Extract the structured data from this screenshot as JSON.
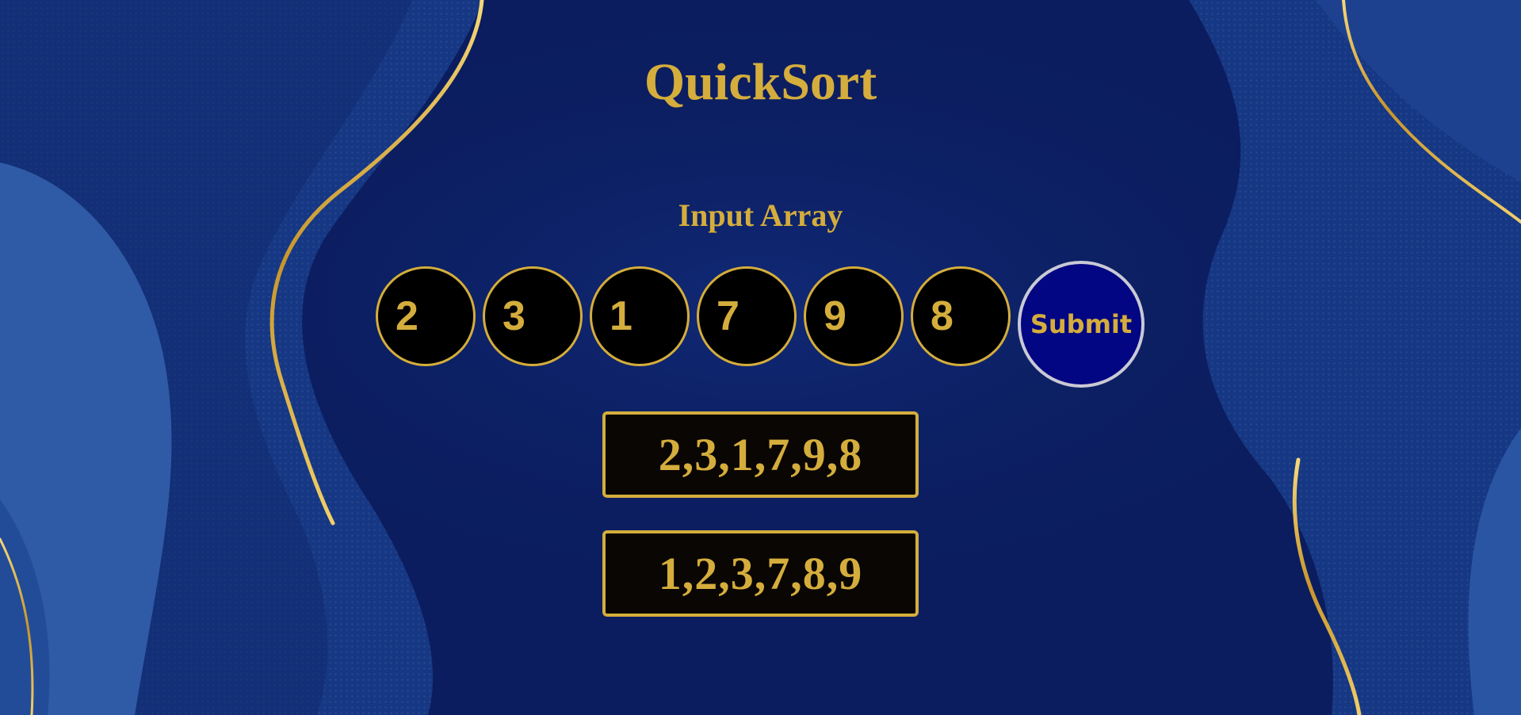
{
  "page": {
    "title": "QuickSort",
    "input_label": "Input Array"
  },
  "inputs": [
    {
      "value": "2"
    },
    {
      "value": "3"
    },
    {
      "value": "1"
    },
    {
      "value": "7"
    },
    {
      "value": "9"
    },
    {
      "value": "8"
    }
  ],
  "submit": {
    "label": "Submit"
  },
  "results": {
    "original": "2,3,1,7,9,8",
    "sorted": "1,2,3,7,8,9"
  },
  "colors": {
    "accent_gold": "#d4ad3c",
    "background_navy": "#0b1d5e",
    "submit_fill": "#020682",
    "submit_border": "#c9c9d6",
    "field_fill": "#000000"
  }
}
